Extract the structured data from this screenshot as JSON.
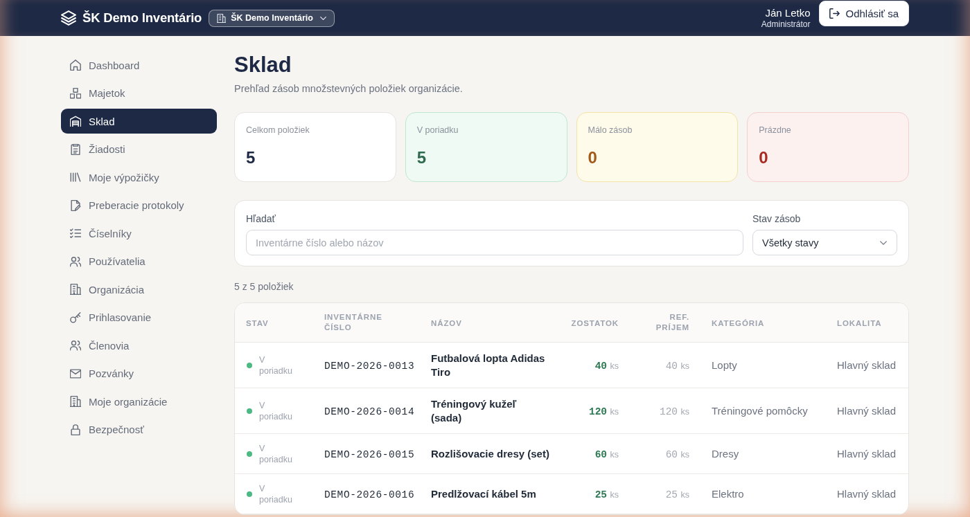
{
  "header": {
    "app_title": "ŠK Demo Inventário",
    "org_selector": "ŠK Demo Inventário",
    "user_name": "Ján Letko",
    "user_role": "Administrátor",
    "logout_button": "Odhlásiť sa"
  },
  "sidebar": {
    "items": [
      {
        "label": "Dashboard",
        "selected": false
      },
      {
        "label": "Majetok",
        "selected": false
      },
      {
        "label": "Sklad",
        "selected": true
      },
      {
        "label": "Žiadosti",
        "selected": false
      },
      {
        "label": "Moje výpožičky",
        "selected": false
      },
      {
        "label": "Preberacie protokoly",
        "selected": false
      },
      {
        "label": "Číselníky",
        "selected": false
      },
      {
        "label": "Používatelia",
        "selected": false
      },
      {
        "label": "Organizácia",
        "selected": false
      },
      {
        "label": "Prihlasovanie",
        "selected": false
      },
      {
        "label": "Členovia",
        "selected": false
      },
      {
        "label": "Pozvánky",
        "selected": false
      },
      {
        "label": "Moje organizácie",
        "selected": false
      },
      {
        "label": "Bezpečnosť",
        "selected": false
      }
    ]
  },
  "page": {
    "title": "Sklad",
    "subtitle": "Prehľad zásob množstevných položiek organizácie."
  },
  "stats": [
    {
      "kind": "total",
      "label": "Celkom položiek",
      "value": "5"
    },
    {
      "kind": "ok",
      "label": "V poriadku",
      "value": "5"
    },
    {
      "kind": "low",
      "label": "Málo zásob",
      "value": "0"
    },
    {
      "kind": "empty",
      "label": "Prázdne",
      "value": "0"
    }
  ],
  "filters": {
    "search": {
      "label": "Hľadať",
      "placeholder": "Inventárne číslo alebo názov"
    },
    "stock_state": {
      "label": "Stav zásob",
      "value": "Všetky stavy"
    }
  },
  "result_count": "5 z 5 položiek",
  "table": {
    "columns": [
      "STAV",
      "INVENTÁRNE ČÍSLO",
      "NÁZOV",
      "ZOSTATOK",
      "REF. PRÍJEM",
      "KATEGÓRIA",
      "LOKALITA"
    ],
    "rows": [
      {
        "status": "V poriadku",
        "color": "#4cb884",
        "inventory_number": "DEMO-2026-0013",
        "name": "Futbalová lopta Adidas Tiro",
        "remaining": "40",
        "remaining_unit": "ks",
        "ref_received": "40",
        "ref_unit": "ks",
        "category": "Lopty",
        "location": "Hlavný sklad"
      },
      {
        "status": "V poriadku",
        "color": "#4cb884",
        "inventory_number": "DEMO-2026-0014",
        "name": "Tréningový kužeľ (sada)",
        "remaining": "120",
        "remaining_unit": "ks",
        "ref_received": "120",
        "ref_unit": "ks",
        "category": "Tréningové pomôcky",
        "location": "Hlavný sklad"
      },
      {
        "status": "V poriadku",
        "color": "#4cb884",
        "inventory_number": "DEMO-2026-0015",
        "name": "Rozlišovacie dresy (set)",
        "remaining": "60",
        "remaining_unit": "ks",
        "ref_received": "60",
        "ref_unit": "ks",
        "category": "Dresy",
        "location": "Hlavný sklad"
      },
      {
        "status": "V poriadku",
        "color": "#4cb884",
        "inventory_number": "DEMO-2026-0016",
        "name": "Predlžovací kábel 5m",
        "remaining": "25",
        "remaining_unit": "ks",
        "ref_received": "25",
        "ref_unit": "ks",
        "category": "Elektro",
        "location": "Hlavný sklad"
      }
    ]
  }
}
